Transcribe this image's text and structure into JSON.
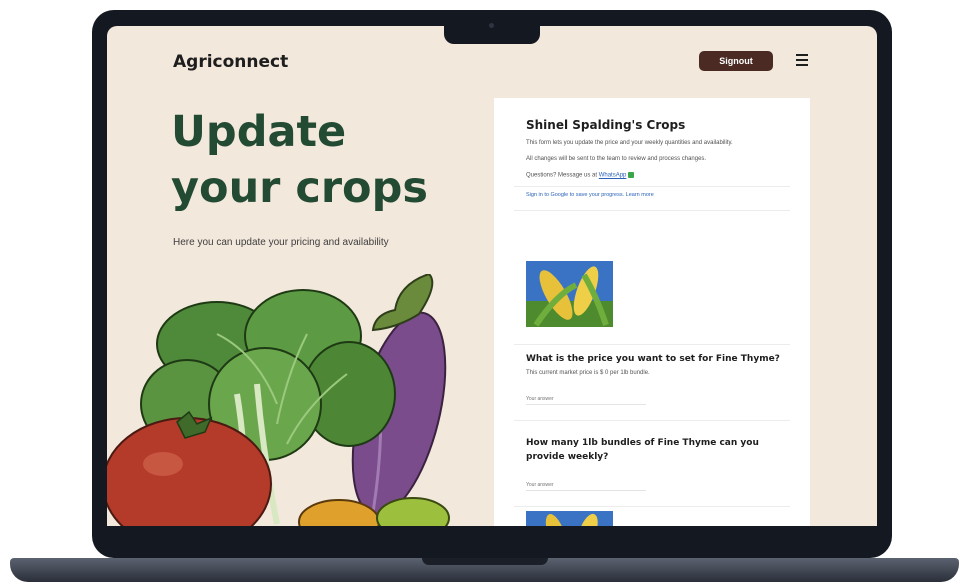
{
  "header": {
    "brand": "Agriconnect",
    "signout_label": "Signout"
  },
  "hero": {
    "title_line1": "Update",
    "title_line2": "your crops",
    "subtitle": "Here you can update your pricing and availability"
  },
  "card": {
    "title": "Shinel Spalding's Crops",
    "intro_line1": "This form lets you update the price and your weekly quantities and availability.",
    "intro_line2": "All changes will be sent to the team to review and process changes.",
    "contact_prefix": "Questions? Message us at",
    "contact_link": "WhatsApp",
    "footer_link": "Sign in to Google to save your progress. Learn more"
  },
  "questions": [
    {
      "title": "What is the price you want to set for Fine Thyme?",
      "help": "This current market price is $ 0 per 1lb bundle.",
      "placeholder": "Your answer"
    },
    {
      "title": "How many 1lb bundles of Fine Thyme can you provide weekly?",
      "help": "",
      "placeholder": "Your answer"
    }
  ],
  "colors": {
    "screen_bg": "#f3e8dc",
    "brand_green": "#234a33",
    "signout_bg": "#4a2a22"
  }
}
